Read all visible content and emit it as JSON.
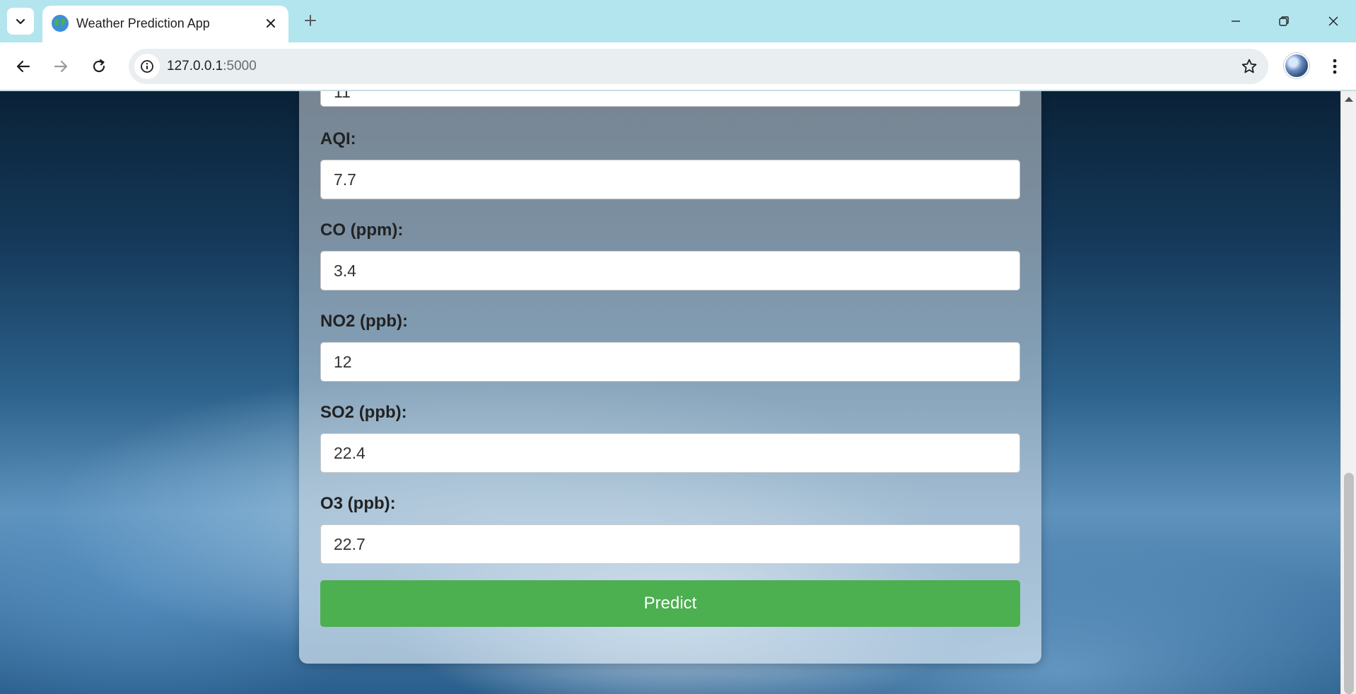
{
  "browser": {
    "tab_title": "Weather Prediction App",
    "url_host": "127.0.0.1",
    "url_port": ":5000"
  },
  "form": {
    "fields": [
      {
        "label": "",
        "value": "11"
      },
      {
        "label": "AQI:",
        "value": "7.7"
      },
      {
        "label": "CO (ppm):",
        "value": "3.4"
      },
      {
        "label": "NO2 (ppb):",
        "value": "12"
      },
      {
        "label": "SO2 (ppb):",
        "value": "22.4"
      },
      {
        "label": "O3 (ppb):",
        "value": "22.7"
      }
    ],
    "submit_label": "Predict"
  },
  "colors": {
    "button": "#4caf50",
    "tab_strip": "#b3e5ef"
  },
  "icons": [
    "tab-search-icon",
    "globe-favicon-icon",
    "close-icon",
    "plus-icon",
    "minimize-icon",
    "restore-icon",
    "back-icon",
    "forward-icon",
    "reload-icon",
    "info-icon",
    "star-icon",
    "profile-avatar",
    "kebab-menu-icon"
  ]
}
